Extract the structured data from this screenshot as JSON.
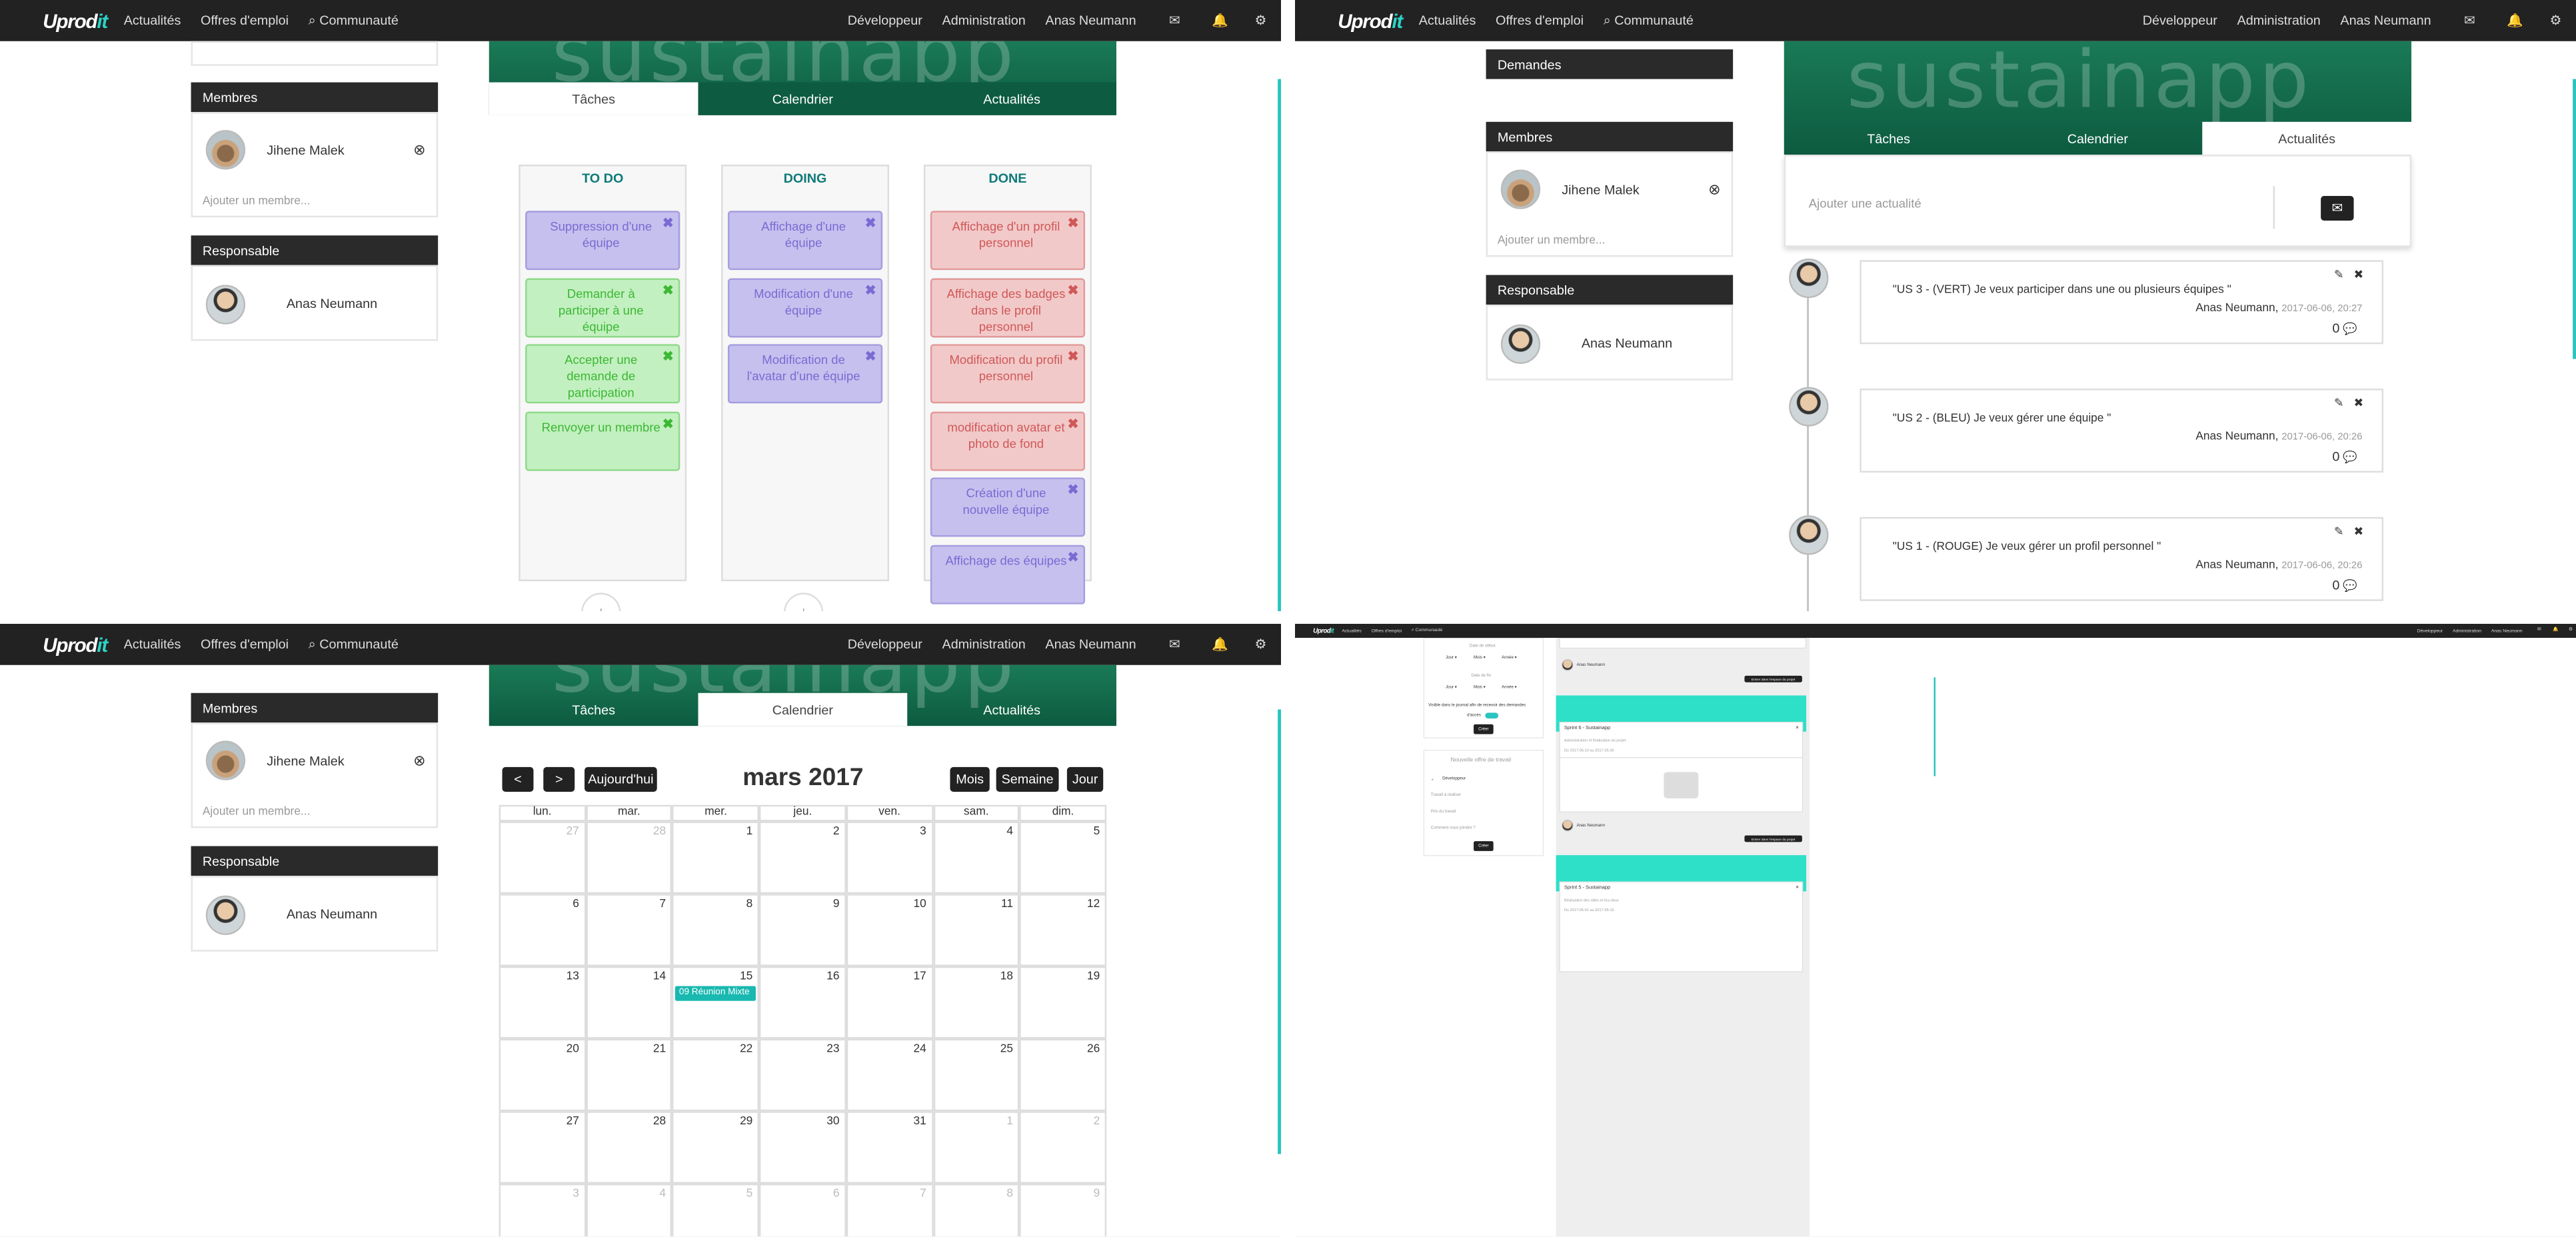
{
  "nav": {
    "logo_a": "Uprod",
    "logo_b": "it",
    "actualites": "Actualités",
    "offres": "Offres d'emploi",
    "communaute": "Communauté",
    "developpeur": "Développeur",
    "administration": "Administration",
    "user": "Anas Neumann"
  },
  "sidebar": {
    "demandes": "Demandes",
    "membres": "Membres",
    "member_name": "Jihene Malek",
    "add_member": "Ajouter un membre...",
    "responsable": "Responsable",
    "responsable_name": "Anas Neumann"
  },
  "project": {
    "banner": "sustainapp",
    "tabs": [
      "Tâches",
      "Calendrier",
      "Actualités"
    ]
  },
  "kanban": {
    "columns": [
      {
        "title": "TO DO",
        "tasks": [
          {
            "t": "Suppression d'une équipe",
            "c": "v"
          },
          {
            "t": "Demander à participer à une équipe",
            "c": "g"
          },
          {
            "t": "Accepter une demande de participation",
            "c": "g"
          },
          {
            "t": "Renvoyer un membre",
            "c": "g"
          }
        ]
      },
      {
        "title": "DOING",
        "tasks": [
          {
            "t": "Affichage d'une équipe",
            "c": "v"
          },
          {
            "t": "Modification d'une équipe",
            "c": "v"
          },
          {
            "t": "Modification de l'avatar d'une équipe",
            "c": "v"
          }
        ]
      },
      {
        "title": "DONE",
        "tasks": [
          {
            "t": "Affichage d'un profil personnel",
            "c": "r"
          },
          {
            "t": "Affichage des badges dans le profil personnel",
            "c": "r"
          },
          {
            "t": "Modification du profil personnel",
            "c": "r"
          },
          {
            "t": "modification avatar et photo de fond",
            "c": "r"
          },
          {
            "t": "Création d'une nouvelle équipe",
            "c": "v"
          },
          {
            "t": "Affichage des équipes",
            "c": "v"
          }
        ]
      }
    ]
  },
  "news": {
    "placeholder": "Ajouter une actualité",
    "posts": [
      {
        "text": "\"US 3 - (VERT) Je veux participer dans une ou plusieurs équipes \"",
        "author": "Anas Neumann,",
        "date": "2017-06-06, 20:27",
        "count": "0"
      },
      {
        "text": "\"US 2 - (BLEU) Je veux gérer une équipe \"",
        "author": "Anas Neumann,",
        "date": "2017-06-06, 20:26",
        "count": "0"
      },
      {
        "text": "\"US 1 - (ROUGE) Je veux gérer un profil personnel \"",
        "author": "Anas Neumann,",
        "date": "2017-06-06, 20:26",
        "count": "0"
      }
    ]
  },
  "calendar": {
    "prev": "<",
    "next": ">",
    "today": "Aujourd'hui",
    "title": "mars 2017",
    "views": [
      "Mois",
      "Semaine",
      "Jour"
    ],
    "weekdays": [
      "lun.",
      "mar.",
      "mer.",
      "jeu.",
      "ven.",
      "sam.",
      "dim."
    ],
    "weeks": [
      [
        "27",
        "28",
        "1",
        "2",
        "3",
        "4",
        "5"
      ],
      [
        "6",
        "7",
        "8",
        "9",
        "10",
        "11",
        "12"
      ],
      [
        "13",
        "14",
        "15",
        "16",
        "17",
        "18",
        "19"
      ],
      [
        "20",
        "21",
        "22",
        "23",
        "24",
        "25",
        "26"
      ],
      [
        "27",
        "28",
        "29",
        "30",
        "31",
        "1",
        "2"
      ],
      [
        "3",
        "4",
        "5",
        "6",
        "7",
        "8",
        "9"
      ]
    ],
    "event": "09 Réunion Mixte"
  },
  "sprintform": {
    "date_debut": "Date de début",
    "date_fin": "Date de fin",
    "jour": "Jour",
    "mois": "Mois",
    "annee": "Année",
    "visible": "Visible dans le journal afin de recevoir des demandes",
    "acces": "d'accès",
    "creer": "Créer"
  },
  "jobform": {
    "title": "Nouvelle offre de travail",
    "category": "Développeur",
    "f1": "Travail à réaliser",
    "f2": "Prix du travail",
    "f3": "Comment vous joindre ?",
    "creer": "Créer"
  },
  "sprints": {
    "owner": "Anas Neumann",
    "enter": "Entrer dans l'espace du projet",
    "s6_title": "Sprint 6 - Sustainapp",
    "s6_desc": "Administration et finalisation du projet",
    "s6_dates": "Du 2017-05-14 au 2017-05-30",
    "s5_title": "Sprint 5 - Sustainapp",
    "s5_desc": "Réalisation des villes et éco-lieux",
    "s5_dates": "Du 2017-05-01 au 2017-05-15"
  }
}
